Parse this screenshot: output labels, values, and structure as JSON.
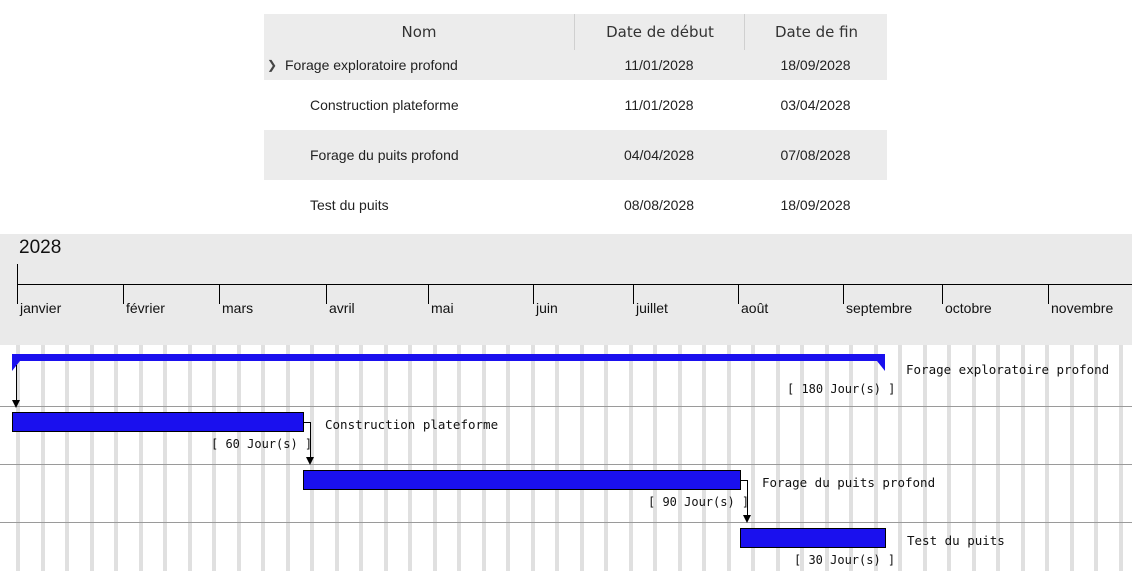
{
  "table": {
    "headers": {
      "name": "Nom",
      "start": "Date de début",
      "end": "Date de fin"
    },
    "rows": [
      {
        "name": "Forage exploratoire profond",
        "start": "11/01/2028",
        "end": "18/09/2028",
        "expanded_icon": "chevron-down-icon"
      },
      {
        "name": "Construction plateforme",
        "start": "11/01/2028",
        "end": "03/04/2028"
      },
      {
        "name": "Forage du puits profond",
        "start": "04/04/2028",
        "end": "07/08/2028"
      },
      {
        "name": "Test du puits",
        "start": "08/08/2028",
        "end": "18/09/2028"
      }
    ]
  },
  "timeline": {
    "year": "2028",
    "months": [
      "janvier",
      "février",
      "mars",
      "avril",
      "mai",
      "juin",
      "juillet",
      "août",
      "septembre",
      "octobre",
      "novembre"
    ],
    "bar_color": "#1a10ee",
    "tasks": [
      {
        "label": "Forage exploratoire profond",
        "duration": "[ 180 Jour(s) ]",
        "summary": true
      },
      {
        "label": "Construction plateforme",
        "duration": "[ 60 Jour(s) ]"
      },
      {
        "label": "Forage du puits profond",
        "duration": "[ 90 Jour(s) ]"
      },
      {
        "label": "Test du puits",
        "duration": "[ 30 Jour(s) ]"
      }
    ]
  }
}
